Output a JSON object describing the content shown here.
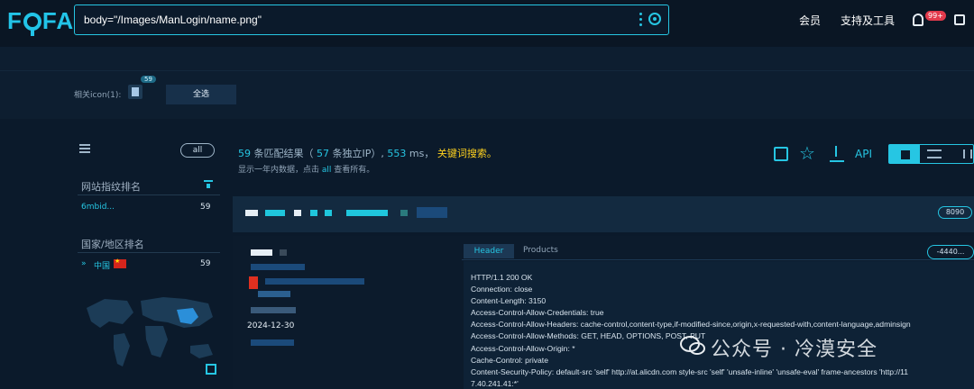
{
  "header": {
    "logo": "FOFA",
    "search_query": "body=\"/Images/ManLogin/name.png\"",
    "nav_member": "会员",
    "nav_tools": "支持及工具",
    "notifications_badge": "99+"
  },
  "related_icons": {
    "label": "相关icon(1):",
    "icon_count": "59",
    "select_all": "全选"
  },
  "sidebar": {
    "all_pill": "all",
    "fingerprint_title": "网站指纹排名",
    "fingerprint_items": [
      {
        "name": "6mbid...",
        "count": "59"
      }
    ],
    "country_title": "国家/地区排名",
    "country_items": [
      {
        "name": "中国",
        "count": "59"
      }
    ]
  },
  "summary": {
    "matches": "59",
    "matches_label": "条匹配结果（",
    "unique_ip": "57",
    "unique_ip_label": "条独立IP）,",
    "time": "553",
    "time_label": "ms，",
    "keyword_search": "关键词搜索。",
    "note_prefix": "显示一年内数据，点击",
    "note_link": "all",
    "note_suffix": "查看所有。",
    "api_label": "API"
  },
  "result": {
    "port": "8090",
    "date": "2024-12-30",
    "id_pill": "-4440...",
    "tab_header": "Header",
    "tab_products": "Products",
    "headers": [
      "HTTP/1.1 200 OK",
      "Connection: close",
      "Content-Length: 3150",
      "Access-Control-Allow-Credentials: true",
      "Access-Control-Allow-Headers: cache-control,content-type,if-modified-since,origin,x-requested-with,content-language,adminsign",
      "Access-Control-Allow-Methods: GET, HEAD, OPTIONS, POST, PUT",
      "Access-Control-Allow-Origin: *",
      "Cache-Control: private",
      "Content-Security-Policy: default-src 'self' http://at.alicdn.com style-src 'self' 'unsafe-inline' 'unsafe-eval' frame-ancestors 'http://11",
      "7.40.241.41:*'"
    ]
  },
  "watermark": "公众号 · 冷漠安全",
  "colors": {
    "accent": "#26c6e3",
    "keyword": "#ffd21f",
    "background": "#0b1a2b",
    "badge": "#e33a4c"
  }
}
